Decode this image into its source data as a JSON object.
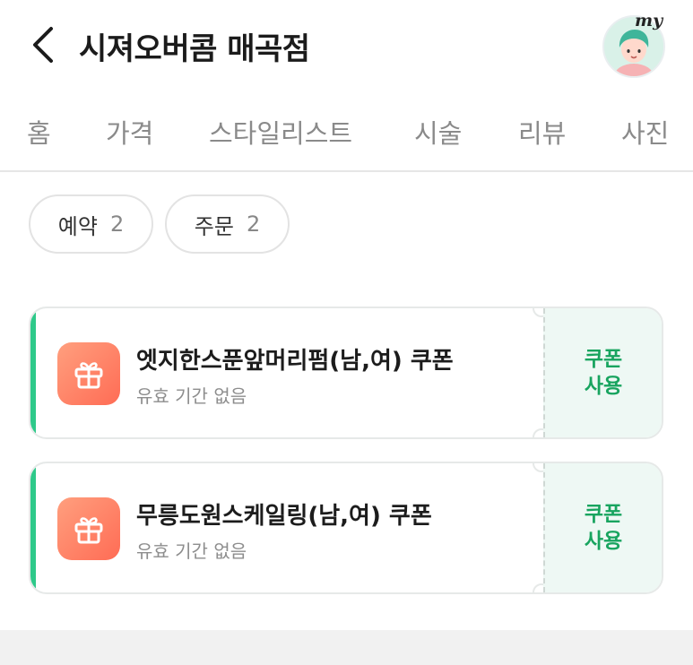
{
  "header": {
    "back_icon": "chevron-left-icon",
    "title": "시져오버콤 매곡점",
    "avatar_icon": "avatar-icon",
    "my_label": "my"
  },
  "tabs": [
    {
      "label": "홈"
    },
    {
      "label": "가격"
    },
    {
      "label": "스타일리스트"
    },
    {
      "label": "시술"
    },
    {
      "label": "리뷰"
    },
    {
      "label": "사진"
    }
  ],
  "filters": [
    {
      "label": "예약",
      "count": "2"
    },
    {
      "label": "주문",
      "count": "2"
    }
  ],
  "coupons": [
    {
      "icon": "gift-icon",
      "name": "엣지한스푼앞머리펌(남,여) 쿠폰",
      "validity": "유효 기간 없음",
      "action_label": "쿠폰 사용"
    },
    {
      "icon": "gift-icon",
      "name": "무릉도원스케일링(남,여) 쿠폰",
      "validity": "유효 기간 없음",
      "action_label": "쿠폰 사용"
    }
  ],
  "colors": {
    "accent_green": "#2ec98a",
    "action_green": "#18a45f",
    "gift_gradient_start": "#ff9f7e",
    "gift_gradient_end": "#ff6c55"
  }
}
